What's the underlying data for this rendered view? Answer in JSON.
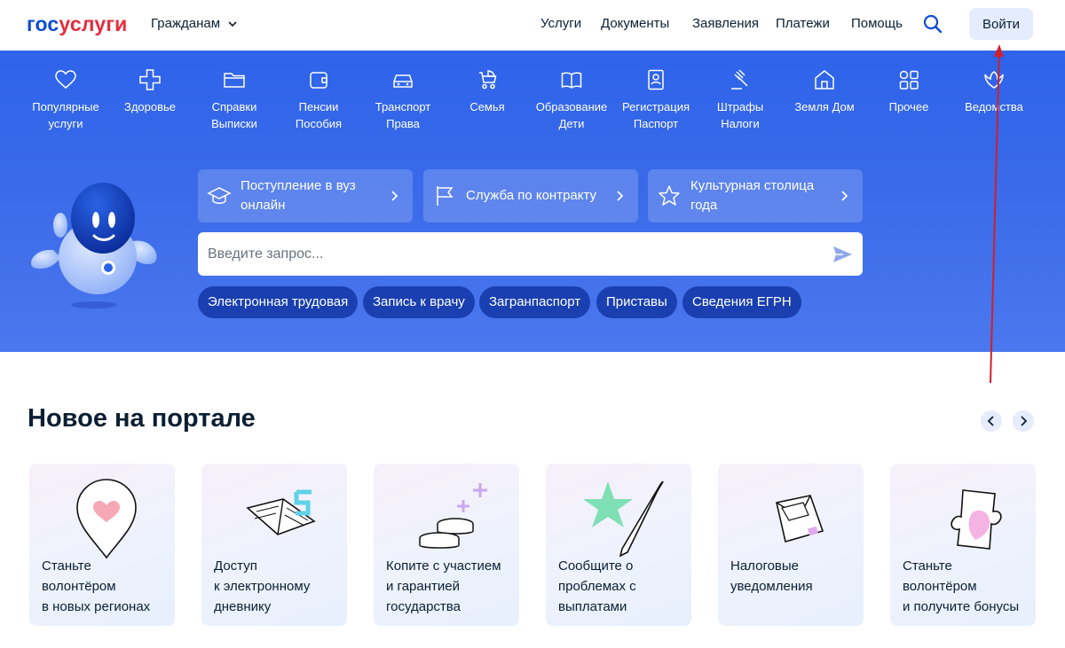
{
  "header": {
    "logo_part1": "гос",
    "logo_part2": "услуги",
    "audience": "Гражданам",
    "nav": [
      "Услуги",
      "Документы",
      "Заявления",
      "Платежи",
      "Помощь"
    ],
    "login_label": "Войти",
    "accent": "#0d4cd3",
    "logo_red": "#e52c3d"
  },
  "categories": [
    {
      "icon": "heart-icon",
      "label": "Популярные\nуслуги"
    },
    {
      "icon": "plus-cross-icon",
      "label": "Здоровье"
    },
    {
      "icon": "folder-icon",
      "label": "Справки\nВыписки"
    },
    {
      "icon": "wallet-icon",
      "label": "Пенсии\nПособия"
    },
    {
      "icon": "car-icon",
      "label": "Транспорт\nПрава"
    },
    {
      "icon": "stroller-icon",
      "label": "Семья"
    },
    {
      "icon": "book-icon",
      "label": "Образование\nДети"
    },
    {
      "icon": "id-card-icon",
      "label": "Регистрация\nПаспорт"
    },
    {
      "icon": "gavel-icon",
      "label": "Штрафы\nНалоги"
    },
    {
      "icon": "house-icon",
      "label": "Земля Дом"
    },
    {
      "icon": "grid-icon",
      "label": "Прочее"
    },
    {
      "icon": "emblem-icon",
      "label": "Ведомства"
    }
  ],
  "promos": [
    {
      "icon": "graduation-cap-icon",
      "label": "Поступление в вуз онлайн"
    },
    {
      "icon": "flag-icon",
      "label": "Служба по контракту"
    },
    {
      "icon": "star-icon",
      "label": "Культурная столица года"
    }
  ],
  "search": {
    "placeholder": "Введите запрос...",
    "value": ""
  },
  "chips": [
    "Электронная трудовая",
    "Запись к врачу",
    "Загранпаспорт",
    "Приставы",
    "Сведения ЕГРН"
  ],
  "news": {
    "title": "Новое на портале",
    "cards": [
      {
        "icon": "heart-pin-icon",
        "label": "Станьте\nволонтёром\nв новых регионах"
      },
      {
        "icon": "open-diary-icon",
        "label": "Доступ\nк электронному\nдневнику"
      },
      {
        "icon": "coins-icon",
        "label": "Копите с участием\nи гарантией\nгосударства"
      },
      {
        "icon": "star-pen-icon",
        "label": "Сообщите о\nпроблемах с\nвыплатами"
      },
      {
        "icon": "envelope-icon",
        "label": "Налоговые\nуведомления"
      },
      {
        "icon": "puzzle-icon",
        "label": "Станьте\nволонтёром\nи получите бонусы"
      }
    ]
  },
  "colors": {
    "hero": "#3a6ae9",
    "chip": "#1a3fb0",
    "annotation": "#d0202a"
  }
}
